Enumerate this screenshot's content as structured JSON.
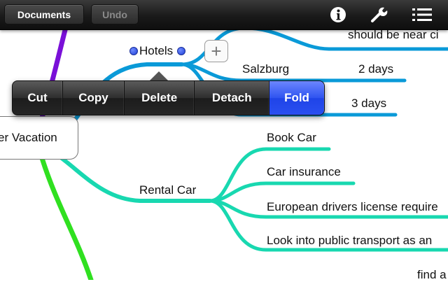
{
  "toolbar": {
    "documents_label": "Documents",
    "undo_label": "Undo",
    "icons": [
      "info-icon",
      "wrench-icon",
      "list-icon"
    ]
  },
  "mindmap": {
    "root": "er Vacation",
    "hotels": "Hotels",
    "top_partial": "should be near ci",
    "salzburg": "Salzburg",
    "salzburg_days": "2 days",
    "second_days": "3 days",
    "rental_car": "Rental Car",
    "book_car": "Book Car",
    "car_insurance": "Car insurance",
    "license": "European drivers license require",
    "transport": "Look into public transport as an",
    "find": "find a"
  },
  "context_menu": {
    "items": [
      "Cut",
      "Copy",
      "Delete",
      "Detach",
      "Fold"
    ],
    "active": "Fold"
  },
  "colors": {
    "purple_branch": "#7a10d8",
    "blue_branch": "#0a9ad8",
    "teal_branch": "#18d8b0",
    "green_branch": "#30e020",
    "menu_active": "#2f54f0"
  }
}
